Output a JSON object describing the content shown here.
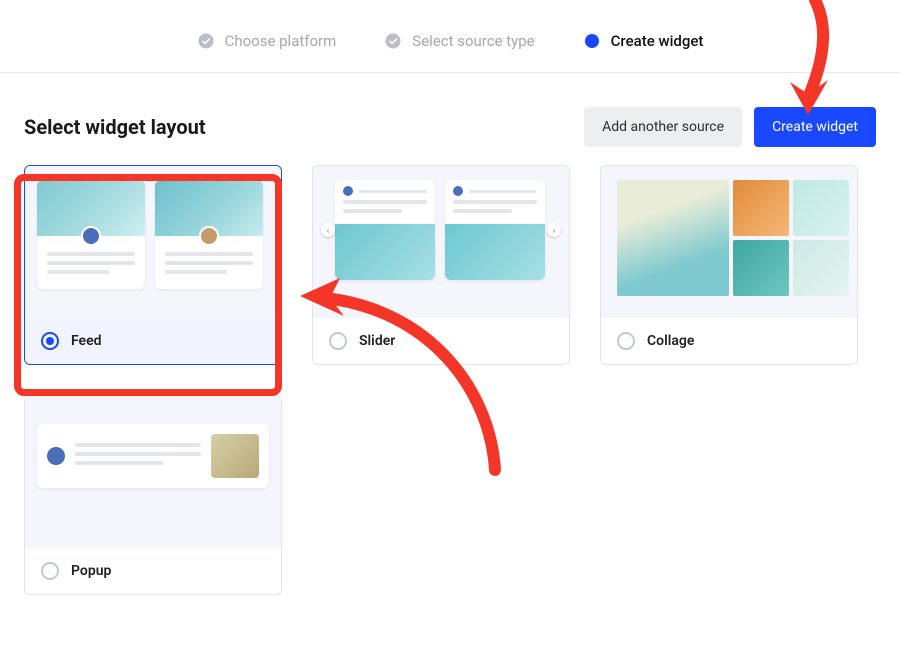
{
  "stepper": {
    "step1": "Choose platform",
    "step2": "Select source type",
    "step3": "Create widget"
  },
  "header": {
    "title": "Select widget layout",
    "add_source_label": "Add another source",
    "create_widget_label": "Create widget"
  },
  "layouts": {
    "feed": "Feed",
    "slider": "Slider",
    "collage": "Collage",
    "popup": "Popup"
  }
}
